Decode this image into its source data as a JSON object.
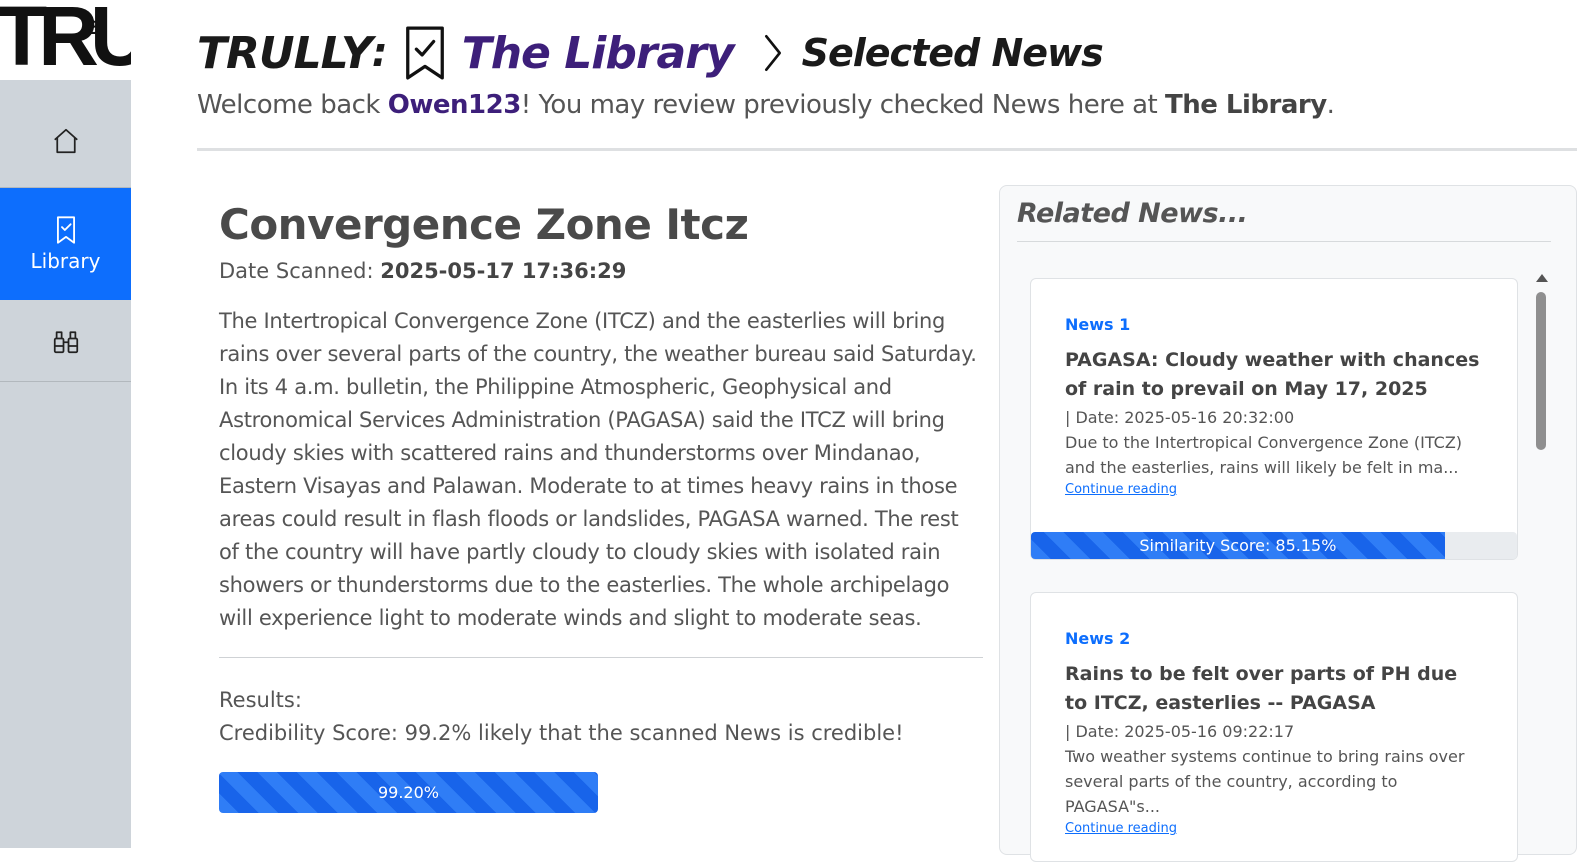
{
  "logo": {
    "text": "TRU",
    "sup": "01"
  },
  "nav": {
    "home_icon": "house-icon",
    "library_label": "Library",
    "library_icon": "bookmark-icon",
    "explore_icon": "binoculars-icon"
  },
  "header": {
    "brand": "TRULLY",
    "colon": ":",
    "library": "The Library",
    "crumb": "Selected News",
    "welcome_pre": "Welcome back ",
    "user": "Owen123",
    "welcome_mid": "! You may review previously checked News here at ",
    "welcome_lib": "The Library",
    "welcome_end": "."
  },
  "article": {
    "title": "Convergence Zone Itcz",
    "date_label": "Date Scanned: ",
    "date_value": "2025-05-17 17:36:29",
    "body": "The Intertropical Convergence Zone (ITCZ) and the easterlies will bring rains over several parts of the country, the weather bureau said Saturday. In its 4 a.m. bulletin, the Philippine Atmospheric, Geophysical and Astronomical Services Administration (PAGASA) said the ITCZ will bring cloudy skies with scattered rains and thunderstorms over Mindanao, Eastern Visayas and Palawan. Moderate to at times heavy rains in those areas could result in flash floods or landslides, PAGASA warned. The rest of the country will have partly cloudy to cloudy skies with isolated rain showers or thunderstorms due to the easterlies. The whole archipelago will experience light to moderate winds and slight to moderate seas.",
    "results_label": "Results:",
    "credibility_text": "Credibility Score: 99.2% likely that the scanned News is credible!",
    "credibility_bar_label": "99.20%",
    "credibility_value": 99.2
  },
  "related": {
    "heading": "Related News...",
    "items": [
      {
        "label": "News 1",
        "title": "PAGASA: Cloudy weather with chances of rain to prevail on May 17, 2025",
        "date": "| Date: 2025-05-16 20:32:00",
        "snippet": "Due to the Intertropical Convergence Zone (ITCZ) and the easterlies, rains will likely be felt in ma...",
        "link": "Continue reading",
        "similarity_label": "Similarity Score: 85.15%",
        "similarity_value": 85.15
      },
      {
        "label": "News 2",
        "title": "Rains to be felt over parts of PH due to ITCZ, easterlies -- PAGASA",
        "date": "| Date: 2025-05-16 09:22:17",
        "snippet": "Two weather systems continue to bring rains over several parts of the country, according to PAGASA\"s...",
        "link": "Continue reading"
      }
    ]
  },
  "colors": {
    "accent": "#0d6efd",
    "brand_purple": "#3d1f7a",
    "sidebar": "#ced4da"
  }
}
